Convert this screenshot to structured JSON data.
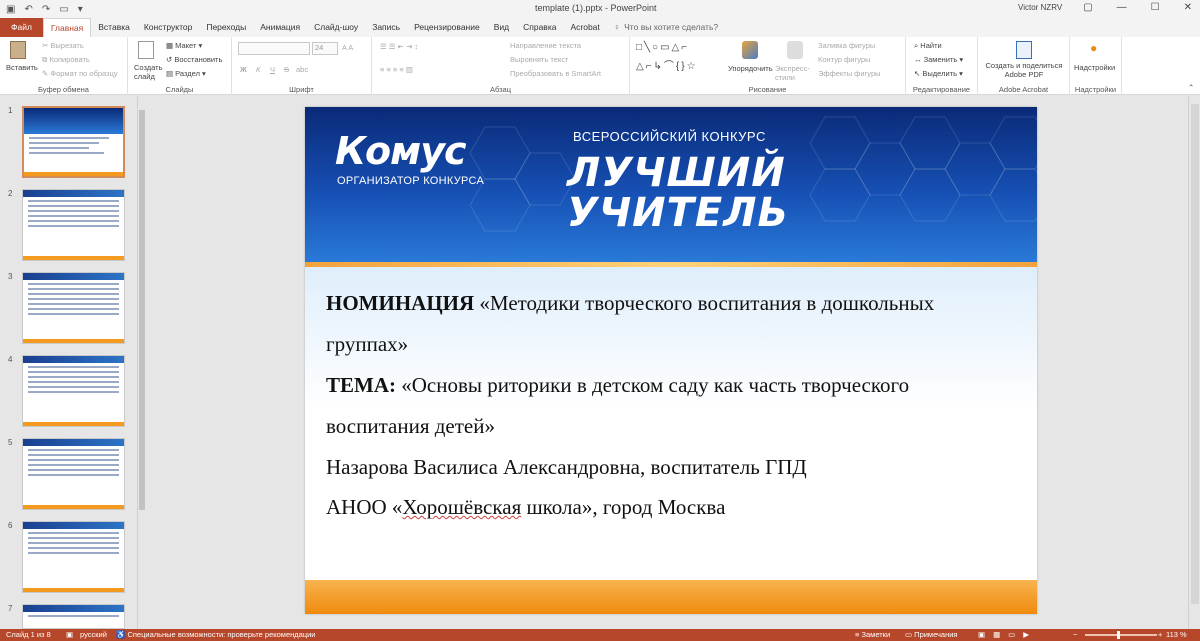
{
  "app": {
    "doc_title": "template (1).pptx  -  PowerPoint",
    "user": "Victor NZRV"
  },
  "tabs": [
    "Файл",
    "Главная",
    "Вставка",
    "Конструктор",
    "Переходы",
    "Анимация",
    "Слайд-шоу",
    "Запись",
    "Рецензирование",
    "Вид",
    "Справка",
    "Acrobat"
  ],
  "tell_me": "Что вы хотите сделать?",
  "ribbon": {
    "clipboard": {
      "paste": "Вставить",
      "cut": "Вырезать",
      "copy": "Копировать",
      "format": "Формат по образцу",
      "label": "Буфер обмена"
    },
    "slides": {
      "new": "Создать слайд",
      "layout": "Макет",
      "reset": "Восстановить",
      "section": "Раздел",
      "label": "Слайды"
    },
    "font": {
      "label": "Шрифт",
      "size": "24",
      "bold": "Ж",
      "italic": "К",
      "underline": "Ч",
      "strike": "S",
      "shadow": "abc"
    },
    "paragraph": {
      "direction": "Направление текста",
      "align": "Выровнять текст",
      "smartart": "Преобразовать в SmartArt",
      "label": "Абзац"
    },
    "drawing": {
      "arrange": "Упорядочить",
      "styles": "Экспресс-стили",
      "fill": "Заливка фигуры",
      "outline": "Контур фигуры",
      "effects": "Эффекты фигуры",
      "label": "Рисование"
    },
    "editing": {
      "find": "Найти",
      "replace": "Заменить",
      "select": "Выделить",
      "label": "Редактирование"
    },
    "acrobat": {
      "create": "Создать и поделиться Adobe PDF",
      "label": "Adobe Acrobat"
    },
    "addins": {
      "addins": "Надстройки",
      "label": "Надстройки"
    }
  },
  "thumbnails": [
    "1",
    "2",
    "3",
    "4",
    "5",
    "6",
    "7"
  ],
  "slide": {
    "logo": "Комус",
    "logo_sub": "ОРГАНИЗАТОР КОНКУРСА",
    "contest_type": "ВСЕРОССИЙСКИЙ КОНКУРС",
    "contest_name_1": "ЛУЧШИЙ",
    "contest_name_2": "УЧИТЕЛЬ",
    "nomination_label": "НОМИНАЦИЯ",
    "nomination_text_1": " «Методики творческого воспитания в дошкольных",
    "nomination_text_2": "группах»",
    "topic_label": "ТЕМА:",
    "topic_text_1": " «Основы риторики в детском саду как часть творческого",
    "topic_text_2": "воспитания детей»",
    "author": "Назарова Василиса Александровна, воспитатель ГПД",
    "org_pre": "АНОО «",
    "org_underlined": "Хорошёвская",
    "org_post": " школа», город Москва"
  },
  "status": {
    "slide": "Слайд 1 из 8",
    "lang": "русский",
    "accessibility": "Специальные возможности: проверьте рекомендации",
    "notes": "Заметки",
    "comments": "Примечания",
    "zoom": "113 %",
    "zoom_level": 0.45
  },
  "colors": {
    "accent": "#b7472a",
    "banner": "#1650b4",
    "orange": "#f08a0d"
  }
}
